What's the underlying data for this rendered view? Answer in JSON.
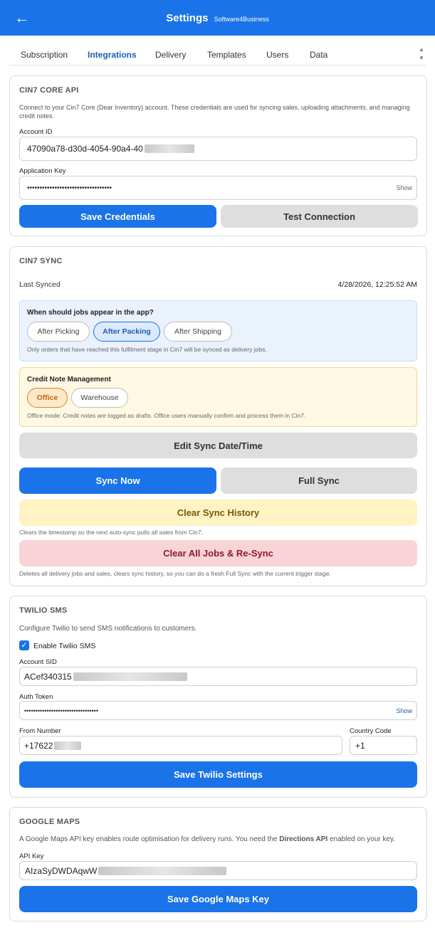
{
  "header": {
    "back_icon": "←",
    "title": "Settings",
    "subtitle": "Software4Business"
  },
  "tabs": [
    {
      "label": "Subscription"
    },
    {
      "label": "Integrations",
      "active": true
    },
    {
      "label": "Delivery"
    },
    {
      "label": "Templates"
    },
    {
      "label": "Users"
    },
    {
      "label": "Data"
    }
  ],
  "scroll": {
    "up": "▲",
    "down": "▼"
  },
  "cin7_core": {
    "title": "CIN7 CORE API",
    "description": "Connect to your Cin7 Core (Dear Inventory) account. These credentials are used for syncing sales, uploading attachments, and managing credit notes.",
    "account_id_label": "Account ID",
    "account_id_value": "47090a78-d30d-4054-90a4-40",
    "app_key_label": "Application Key",
    "app_key_value": "••••••••••••••••••••••••••••••••••",
    "show_label": "Show",
    "save_button": "Save Credentials",
    "test_button": "Test Connection"
  },
  "cin7_sync": {
    "title": "CIN7 SYNC",
    "last_synced_label": "Last Synced",
    "last_synced_value": "4/28/2026, 12:25:52 AM",
    "trigger_question": "When should jobs appear in the app?",
    "trigger_options": [
      "After Picking",
      "After Packing",
      "After Shipping"
    ],
    "trigger_selected": "After Packing",
    "trigger_note": "Only orders that have reached this fulfilment stage in Cin7 will be synced as delivery jobs.",
    "credit_title": "Credit Note Management",
    "credit_options": [
      "Office",
      "Warehouse"
    ],
    "credit_selected": "Office",
    "credit_note": "Office mode: Credit notes are logged as drafts. Office users manually confirm and process them in Cin7.",
    "edit_button": "Edit Sync Date/Time",
    "sync_now_button": "Sync Now",
    "full_sync_button": "Full Sync",
    "clear_history_button": "Clear Sync History",
    "clear_history_note": "Clears the timestamp so the next auto-sync pulls all sales from Cin7.",
    "clear_all_button": "Clear All Jobs & Re-Sync",
    "clear_all_note": "Deletes all delivery jobs and sales, clears sync history, so you can do a fresh Full Sync with the current trigger stage."
  },
  "twilio": {
    "title": "TWILIO SMS",
    "description": "Configure Twilio to send SMS notifications to customers.",
    "enable_label": "Enable Twilio SMS",
    "enabled": true,
    "check_icon": "✓",
    "sid_label": "Account SID",
    "sid_value": "ACef340315",
    "token_label": "Auth Token",
    "token_value": "•••••••••••••••••••••••••••••••••",
    "show_label": "Show",
    "from_label": "From Number",
    "from_value": "+17622",
    "country_label": "Country Code",
    "country_value": "+1",
    "save_button": "Save Twilio Settings"
  },
  "google_maps": {
    "title": "GOOGLE MAPS",
    "description_pre": "A Google Maps API key enables route optimisation for delivery runs. You need the ",
    "description_bold": "Directions API",
    "description_post": " enabled on your key.",
    "api_key_label": "API Key",
    "api_key_value": "AIzaSyDWDAqwW",
    "save_button": "Save Google Maps Key"
  },
  "colors": {
    "primary": "#1a73e8",
    "yellow_button": "#fff3c4",
    "red_button": "#f8d4d8",
    "blue_panel": "#eaf2fd",
    "yellow_panel": "#fff8e3"
  }
}
